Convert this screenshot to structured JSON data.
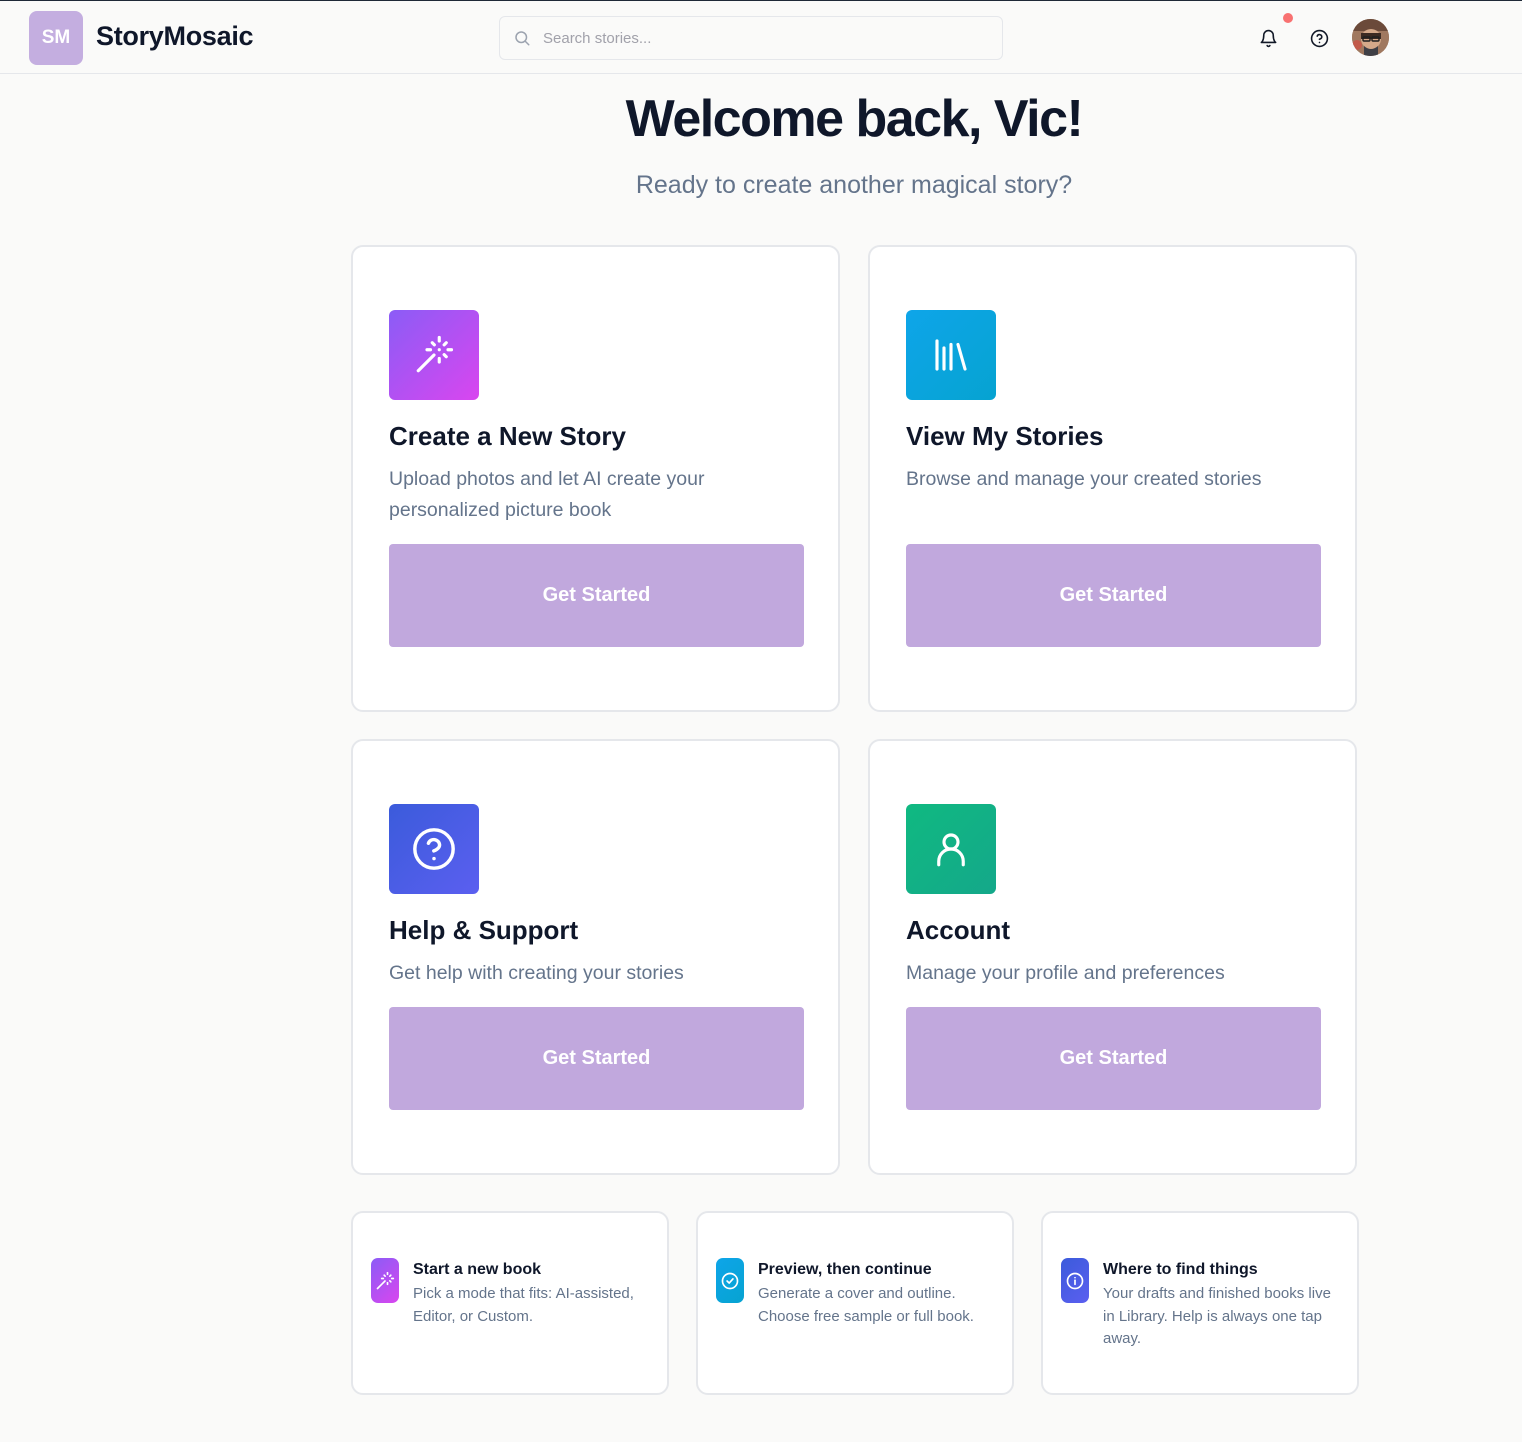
{
  "header": {
    "logo_initials": "SM",
    "brand": "StoryMosaic",
    "search_placeholder": "Search stories...",
    "notification_dot_color": "#f87171",
    "logo_color": "#c4aee0"
  },
  "welcome": {
    "title": "Welcome back, Vic!",
    "subtitle": "Ready to create another magical story?"
  },
  "cards": [
    {
      "title": "Create a New Story",
      "description": "Upload photos and let AI create your personalized picture book",
      "button": "Get Started",
      "icon": "magic-wand-icon"
    },
    {
      "title": "View My Stories",
      "description": "Browse and manage your created stories",
      "button": "Get Started",
      "icon": "library-icon"
    },
    {
      "title": "Help & Support",
      "description": "Get help with creating your stories",
      "button": "Get Started",
      "icon": "help-circle-icon"
    },
    {
      "title": "Account",
      "description": "Manage your profile and preferences",
      "button": "Get Started",
      "icon": "user-icon"
    }
  ],
  "tips": [
    {
      "title": "Start a new book",
      "text": "Pick a mode that fits: AI-assisted, Editor, or Custom.",
      "icon": "magic-wand-icon"
    },
    {
      "title": "Preview, then continue",
      "text": "Generate a cover and outline. Choose free sample or full book.",
      "icon": "check-circle-icon"
    },
    {
      "title": "Where to find things",
      "text": "Your drafts and finished books live in Library. Help is always one tap away.",
      "icon": "info-icon"
    }
  ],
  "colors": {
    "button": "#c1a8dd",
    "create_gradient": [
      "#8b5cf6",
      "#d946ef"
    ],
    "stories_gradient": [
      "#0ea5e9",
      "#06a3d1"
    ],
    "help_gradient": [
      "#3b5bdb",
      "#5b5ff0"
    ],
    "account_gradient": [
      "#10b981",
      "#14a88a"
    ]
  }
}
